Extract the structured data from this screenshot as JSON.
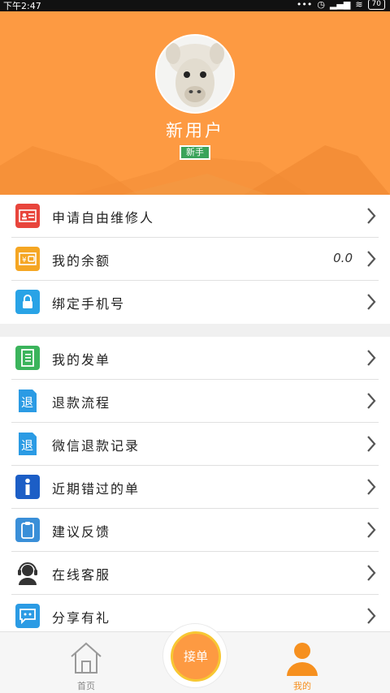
{
  "status_bar": {
    "time": "下午2:47",
    "battery": "70"
  },
  "profile": {
    "username": "新用户",
    "level_badge": "新手"
  },
  "account_menu": [
    {
      "label": "申请自由维修人",
      "icon": "id-card-icon",
      "color": "#e8453c"
    },
    {
      "label": "我的余额",
      "icon": "wallet-icon",
      "color": "#f5a623",
      "value": "0.0"
    },
    {
      "label": "绑定手机号",
      "icon": "lock-icon",
      "color": "#29a3e6"
    }
  ],
  "order_menu": [
    {
      "label": "我的发单",
      "icon": "notebook-icon",
      "color": "#3bb45c"
    },
    {
      "label": "退款流程",
      "icon": "refund-icon",
      "color": "#2b9be4"
    },
    {
      "label": "微信退款记录",
      "icon": "refund-record-icon",
      "color": "#2b9be4"
    },
    {
      "label": "近期错过的单",
      "icon": "info-icon",
      "color": "#1c5ec6"
    },
    {
      "label": "建议反馈",
      "icon": "clipboard-icon",
      "color": "#3a8fd8"
    },
    {
      "label": "在线客服",
      "icon": "headset-icon",
      "color": "#333333"
    },
    {
      "label": "分享有礼",
      "icon": "share-chat-icon",
      "color": "#2b9be4"
    }
  ],
  "tab_bar": {
    "home_label": "首页",
    "center_label": "接单",
    "profile_label": "我的"
  },
  "colors": {
    "accent": "#fd9a42",
    "badge": "#3aa35a",
    "active_tab": "#f6901f"
  }
}
